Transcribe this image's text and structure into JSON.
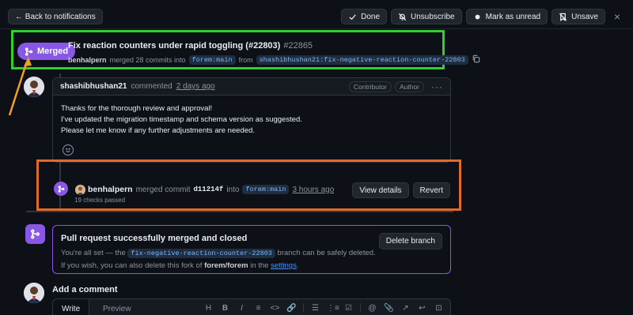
{
  "topbar": {
    "back_label": "← Back to notifications",
    "done_label": "Done",
    "unsubscribe_label": "Unsubscribe",
    "mark_unread_label": "Mark as unread",
    "unsave_label": "Unsave",
    "close_label": "×"
  },
  "pr": {
    "status": "Merged",
    "title": "Fix reaction counters under rapid toggling (#22803)",
    "number": "#22865",
    "author": "benhalpern",
    "meta_text": "merged 28 commits into",
    "base_branch": "forem:main",
    "from_text": "from",
    "head_branch": "shashibhushan21:fix-negative-reaction-counter-22803"
  },
  "comment": {
    "author": "shashibhushan21",
    "commented": "commented",
    "time": "2 days ago",
    "tag_contributor": "Contributor",
    "tag_author": "Author",
    "kebab": "···",
    "lines": [
      "Thanks for the thorough review and approval!",
      "I've updated the migration timestamp and schema version as suggested.",
      "Please let me know if any further adjustments are needed."
    ]
  },
  "merge_event": {
    "author": "benhalpern",
    "text": "merged commit",
    "sha": "d11214f",
    "into_text": "into",
    "branch": "forem:main",
    "time": "3 hours ago",
    "checks": "19 checks passed",
    "view_details": "View details",
    "revert": "Revert"
  },
  "merged_box": {
    "title": "Pull request successfully merged and closed",
    "desc_start": "You're all set — the",
    "branch": "fix-negative-reaction-counter-22803",
    "desc_mid": "branch can be safely deleted. If you wish, you can also delete this fork of",
    "repo": "forem/forem",
    "desc_in": "in the",
    "settings_link": "settings",
    "desc_end": ".",
    "delete_label": "Delete branch"
  },
  "add_comment": {
    "title": "Add a comment",
    "tab_write": "Write",
    "tab_preview": "Preview",
    "toolbar": [
      "H",
      "B",
      "I",
      "≡",
      "<>",
      "🔗",
      "☰",
      "⋮≡",
      "☑",
      "@",
      "📎",
      "↗",
      "↩",
      "⊡"
    ]
  },
  "colors": {
    "merged": "#8957e5",
    "highlight_green": "#2fd12f",
    "highlight_orange": "#e06a2c",
    "arrow": "#f0a020"
  }
}
